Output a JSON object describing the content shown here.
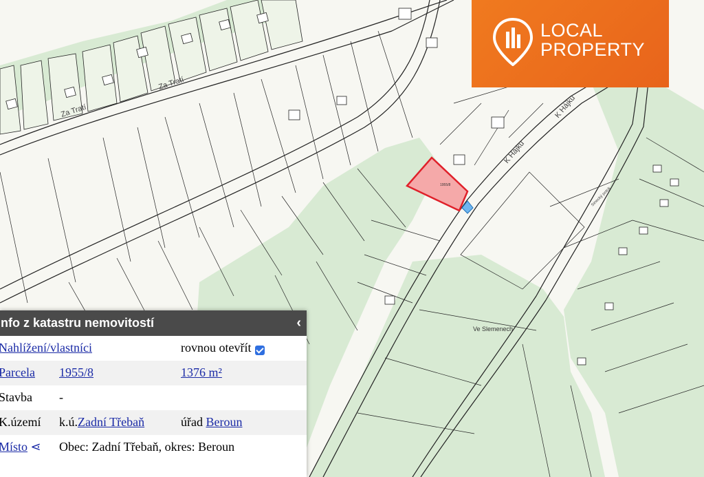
{
  "logo": {
    "line1": "LOCAL",
    "line2": "PROPERTY"
  },
  "map": {
    "street_labels": [
      "Za Tratí",
      "Za Tratí",
      "K Hájku",
      "K Hájku",
      "Ve Slemenech",
      "Sinecký potok"
    ],
    "parcel_label_selected": "1955/8"
  },
  "panel": {
    "title": "Info z katastru nemovitostí",
    "rows": {
      "view": {
        "link": "Nahlížení/vlastníci",
        "text": "rovnou otevřít"
      },
      "parcel": {
        "label": "Parcela",
        "number": "1955/8",
        "area": "1376 m²"
      },
      "building": {
        "label": "Stavba",
        "value": "-"
      },
      "territory": {
        "label": "K.území",
        "prefix": "k.ú.",
        "name": "Zadní Třebaň",
        "office_prefix": "úřad",
        "office": "Beroun"
      },
      "place": {
        "label": "Místo",
        "arrow": "⋖",
        "value": "Obec: Zadní Třebaň, okres: Beroun"
      }
    }
  },
  "colors": {
    "green_area": "#d9ebd3",
    "selected_parcel": "#f5a9a9",
    "selected_border": "#e0202a",
    "accent": "#e8641b"
  }
}
